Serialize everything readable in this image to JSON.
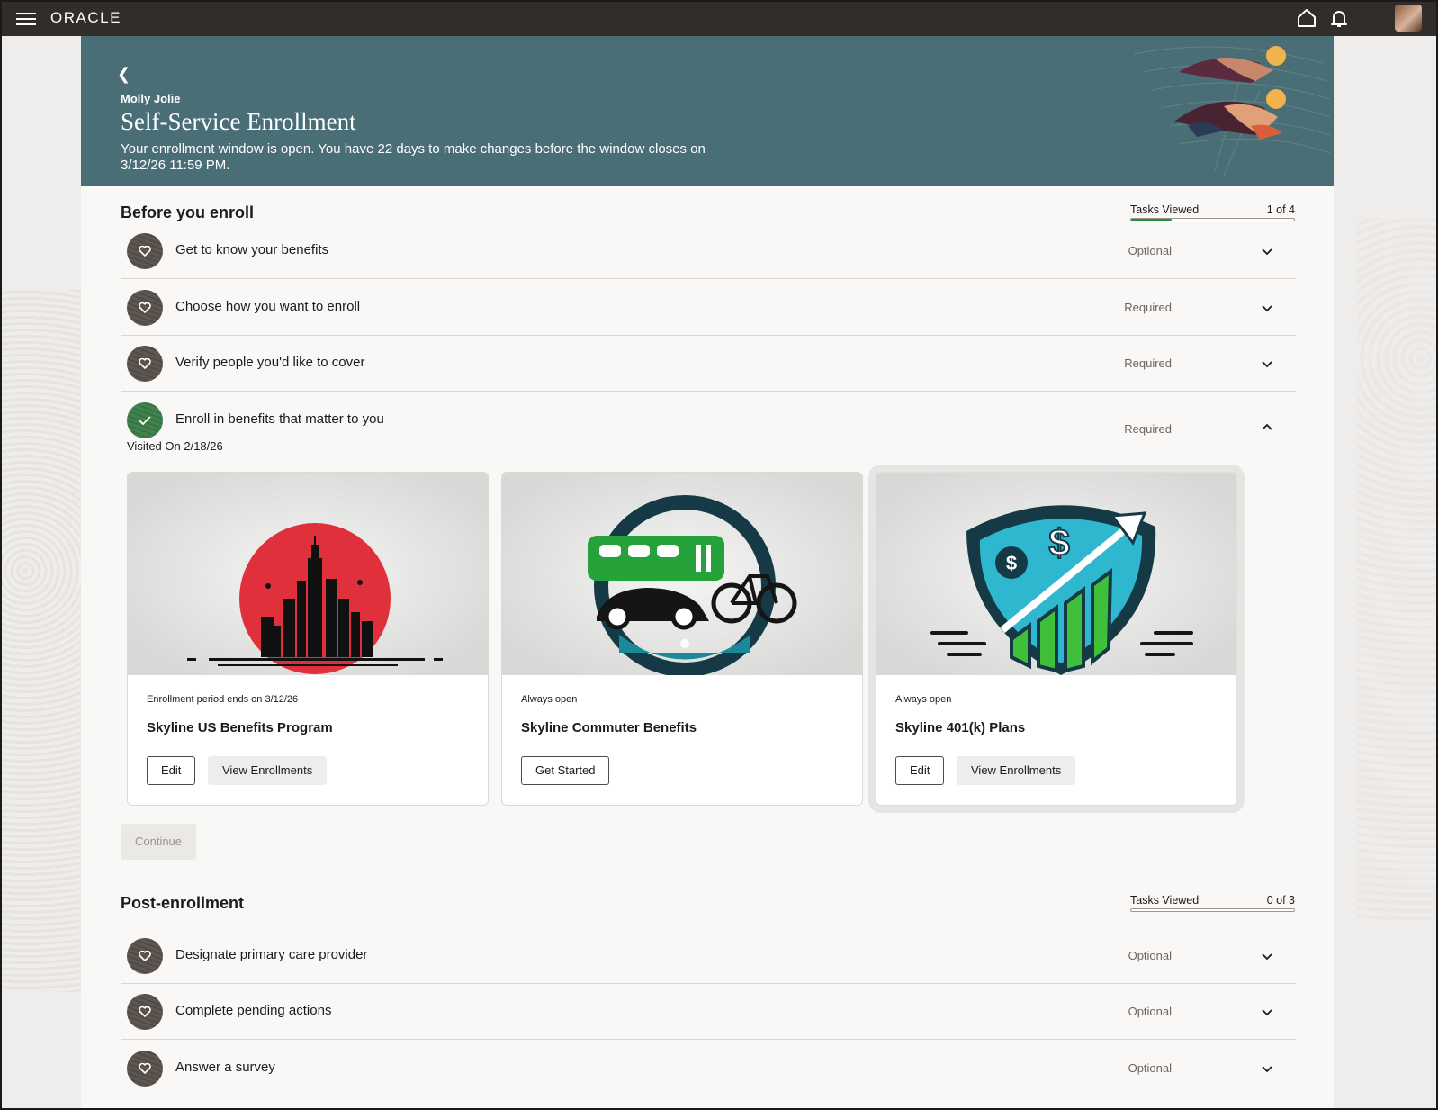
{
  "topbar": {
    "brand": "ORACLE"
  },
  "header": {
    "person": "Molly Jolie",
    "title": "Self-Service Enrollment",
    "description": "Your enrollment window is open. You have 22 days to make changes before the window closes on 3/12/26 11:59 PM."
  },
  "before": {
    "title": "Before you enroll",
    "tasks_label": "Tasks Viewed",
    "tasks_count": "1 of 4",
    "tasks_progress": 0.25,
    "items": [
      {
        "label": "Get to know your benefits",
        "status": "Optional",
        "icon": "heart-icon",
        "expanded": false
      },
      {
        "label": "Choose how you want to enroll",
        "status": "Required",
        "icon": "heart-icon",
        "expanded": false
      },
      {
        "label": "Verify people you'd like to cover",
        "status": "Required",
        "icon": "heart-icon",
        "expanded": false
      },
      {
        "label": "Enroll in benefits that matter to you",
        "status": "Required",
        "icon": "check-icon",
        "expanded": true
      }
    ],
    "visited": "Visited On 2/18/26",
    "cards": [
      {
        "subtitle": "Enrollment period ends on 3/12/26",
        "name": "Skyline US Benefits Program",
        "image": "city-skyline-image",
        "buttons": [
          "Edit",
          "View Enrollments"
        ]
      },
      {
        "subtitle": "Always open",
        "name": "Skyline Commuter Benefits",
        "image": "commuter-transport-image",
        "buttons": [
          "Get Started"
        ]
      },
      {
        "subtitle": "Always open",
        "name": "Skyline 401(k) Plans",
        "image": "retirement-shield-image",
        "buttons": [
          "Edit",
          "View Enrollments"
        ]
      }
    ],
    "continue": "Continue"
  },
  "post": {
    "title": "Post-enrollment",
    "tasks_label": "Tasks Viewed",
    "tasks_count": "0 of 3",
    "tasks_progress": 0,
    "items": [
      {
        "label": "Designate primary care provider",
        "status": "Optional",
        "icon": "heart-icon"
      },
      {
        "label": "Complete pending actions",
        "status": "Optional",
        "icon": "heart-icon"
      },
      {
        "label": "Answer a survey",
        "status": "Optional",
        "icon": "heart-icon"
      }
    ]
  },
  "colors": {
    "topbar": "#312d2a",
    "banner": "#4a6e76",
    "progress": "#2d8a3b",
    "done": "#3d7e4a"
  }
}
